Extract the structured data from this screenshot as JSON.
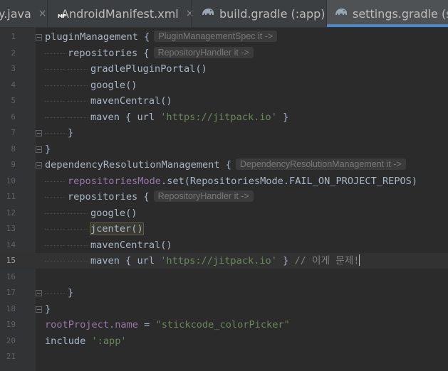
{
  "tabs": [
    {
      "label": "y.java",
      "close": "×",
      "active": false
    },
    {
      "label": "AndroidManifest.xml",
      "icon": "manifest-icon",
      "icon_text": "MF",
      "close": "×",
      "active": false
    },
    {
      "label": "build.gradle (:app)",
      "icon": "gradle-elephant-icon",
      "close": "×",
      "active": false
    },
    {
      "label": "settings.gradle (stick",
      "icon": "gradle-elephant-icon",
      "active": true
    }
  ],
  "editor": {
    "current_line": 15,
    "lines": [
      {
        "n": "1",
        "indent": 0,
        "parts": [
          {
            "t": "pluginManagement {",
            "c": "plain"
          }
        ],
        "hint": "PluginManagementSpec it ->"
      },
      {
        "n": "2",
        "indent": 1,
        "parts": [
          {
            "t": "repositories {",
            "c": "plain"
          }
        ],
        "hint": "RepositoryHandler it ->"
      },
      {
        "n": "3",
        "indent": 2,
        "parts": [
          {
            "t": "gradlePluginPortal()",
            "c": "plain"
          }
        ]
      },
      {
        "n": "4",
        "indent": 2,
        "parts": [
          {
            "t": "google()",
            "c": "plain"
          }
        ]
      },
      {
        "n": "5",
        "indent": 2,
        "parts": [
          {
            "t": "mavenCentral()",
            "c": "plain"
          }
        ]
      },
      {
        "n": "6",
        "indent": 2,
        "parts": [
          {
            "t": "maven { url ",
            "c": "plain"
          },
          {
            "t": "'https://jitpack.io'",
            "c": "str"
          },
          {
            "t": " }",
            "c": "plain"
          }
        ]
      },
      {
        "n": "7",
        "indent": 1,
        "parts": [
          {
            "t": "}",
            "c": "plain"
          }
        ]
      },
      {
        "n": "8",
        "indent": 0,
        "parts": [
          {
            "t": "}",
            "c": "plain"
          }
        ]
      },
      {
        "n": "9",
        "indent": 0,
        "parts": [
          {
            "t": "dependencyResolutionManagement {",
            "c": "plain"
          }
        ],
        "hint": "DependencyResolutionManagement it ->"
      },
      {
        "n": "10",
        "indent": 1,
        "parts": [
          {
            "t": "repositoriesMode",
            "c": "field"
          },
          {
            "t": ".set(RepositoriesMode.FAIL_ON_PROJECT_REPOS)",
            "c": "plain"
          }
        ]
      },
      {
        "n": "11",
        "indent": 1,
        "parts": [
          {
            "t": "repositories {",
            "c": "plain"
          }
        ],
        "hint": "RepositoryHandler it ->"
      },
      {
        "n": "12",
        "indent": 2,
        "parts": [
          {
            "t": "google()",
            "c": "plain"
          }
        ]
      },
      {
        "n": "13",
        "indent": 2,
        "parts": [
          {
            "t": "jcenter()",
            "c": "hl"
          }
        ]
      },
      {
        "n": "14",
        "indent": 2,
        "parts": [
          {
            "t": "mavenCentral()",
            "c": "plain"
          }
        ]
      },
      {
        "n": "15",
        "indent": 2,
        "parts": [
          {
            "t": "maven { url ",
            "c": "plain"
          },
          {
            "t": "'https://jitpack.io'",
            "c": "str"
          },
          {
            "t": " } ",
            "c": "plain"
          },
          {
            "t": "// 이게 문제!",
            "c": "cmt"
          }
        ],
        "caret": true
      },
      {
        "n": "16",
        "indent": 0,
        "parts": []
      },
      {
        "n": "17",
        "indent": 1,
        "parts": [
          {
            "t": "}",
            "c": "plain"
          }
        ]
      },
      {
        "n": "18",
        "indent": 0,
        "parts": [
          {
            "t": "}",
            "c": "plain"
          }
        ]
      },
      {
        "n": "19",
        "indent": 0,
        "parts": [
          {
            "t": "rootProject.name",
            "c": "field"
          },
          {
            "t": " = ",
            "c": "plain"
          },
          {
            "t": "\"stickcode_colorPicker\"",
            "c": "str"
          }
        ]
      },
      {
        "n": "20",
        "indent": 0,
        "parts": [
          {
            "t": "include ",
            "c": "plain"
          },
          {
            "t": "':app'",
            "c": "str"
          }
        ]
      },
      {
        "n": "21",
        "indent": 0,
        "parts": []
      }
    ]
  },
  "colors": {
    "background": "#2b2b2b",
    "string": "#6a8759",
    "field": "#9876aa",
    "comment": "#808080",
    "tab_underline": "#4a88c7"
  }
}
